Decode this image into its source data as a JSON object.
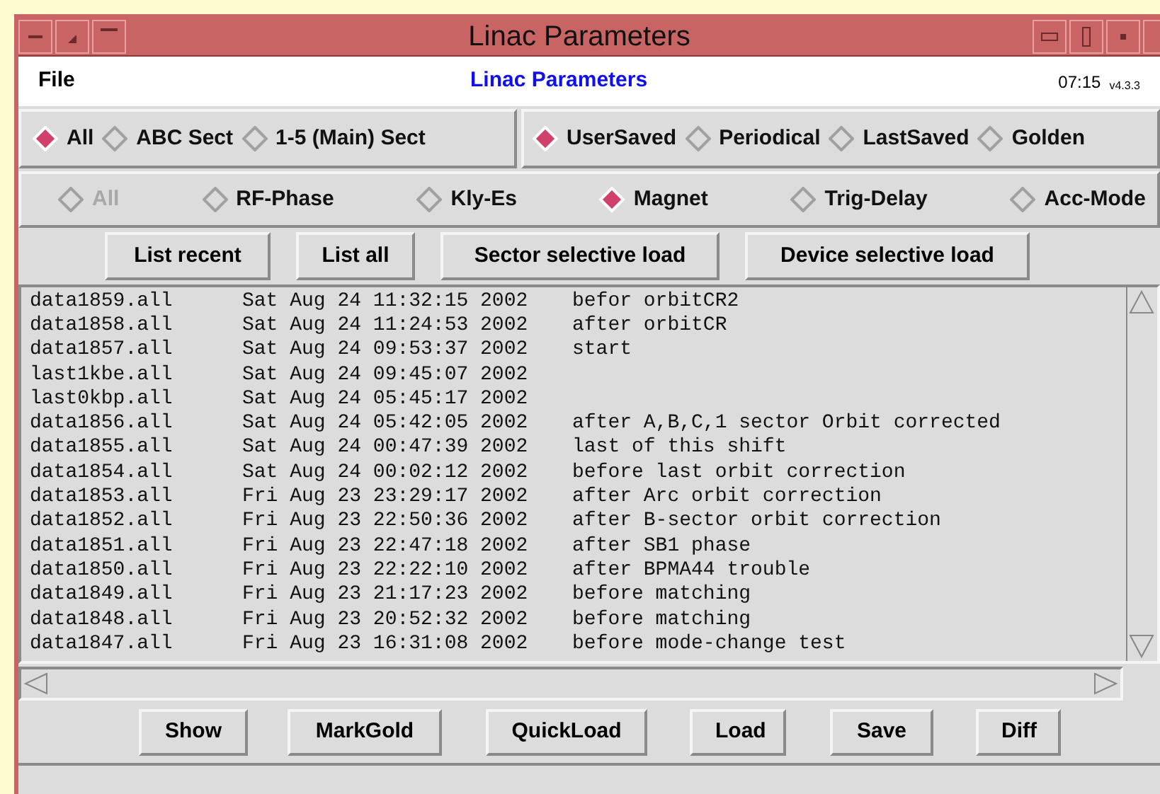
{
  "window": {
    "title": "Linac Parameters"
  },
  "menu": {
    "file": "File",
    "heading": "Linac Parameters",
    "time": "07:15",
    "version": "v4.3.3"
  },
  "section_options": [
    {
      "label": "All",
      "selected": true
    },
    {
      "label": "ABC Sect",
      "selected": false
    },
    {
      "label": "1-5 (Main) Sect",
      "selected": false
    }
  ],
  "source_options": [
    {
      "label": "UserSaved",
      "selected": true
    },
    {
      "label": "Periodical",
      "selected": false
    },
    {
      "label": "LastSaved",
      "selected": false
    },
    {
      "label": "Golden",
      "selected": false
    }
  ],
  "type_options": [
    {
      "label": "All",
      "selected": false,
      "disabled": true
    },
    {
      "label": "RF-Phase",
      "selected": false,
      "disabled": false
    },
    {
      "label": "Kly-Es",
      "selected": false,
      "disabled": false
    },
    {
      "label": "Magnet",
      "selected": true,
      "disabled": false
    },
    {
      "label": "Trig-Delay",
      "selected": false,
      "disabled": false
    },
    {
      "label": "Acc-Mode",
      "selected": false,
      "disabled": false
    }
  ],
  "list_buttons": [
    "List recent",
    "List all",
    "Sector selective load",
    "Device selective load"
  ],
  "files": [
    {
      "name": "data1859.all",
      "date": "Sat Aug 24 11:32:15 2002",
      "comment": "befor orbitCR2"
    },
    {
      "name": "data1858.all",
      "date": "Sat Aug 24 11:24:53 2002",
      "comment": "after orbitCR"
    },
    {
      "name": "data1857.all",
      "date": "Sat Aug 24 09:53:37 2002",
      "comment": "start"
    },
    {
      "name": "last1kbe.all",
      "date": "Sat Aug 24 09:45:07 2002"
    },
    {
      "name": "last0kbp.all",
      "date": "Sat Aug 24 05:45:17 2002"
    },
    {
      "name": "data1856.all",
      "date": "Sat Aug 24 05:42:05 2002",
      "comment": "after A,B,C,1 sector Orbit corrected"
    },
    {
      "name": "data1855.all",
      "date": "Sat Aug 24 00:47:39 2002",
      "comment": "last of this shift"
    },
    {
      "name": "data1854.all",
      "date": "Sat Aug 24 00:02:12 2002",
      "comment": "before last orbit correction"
    },
    {
      "name": "data1853.all",
      "date": "Fri Aug 23 23:29:17 2002",
      "comment": "after Arc orbit correction"
    },
    {
      "name": "data1852.all",
      "date": "Fri Aug 23 22:50:36 2002",
      "comment": "after B-sector orbit correction"
    },
    {
      "name": "data1851.all",
      "date": "Fri Aug 23 22:47:18 2002",
      "comment": "after SB1 phase"
    },
    {
      "name": "data1850.all",
      "date": "Fri Aug 23 22:22:10 2002",
      "comment": "after BPMA44 trouble"
    },
    {
      "name": "data1849.all",
      "date": "Fri Aug 23 21:17:23 2002",
      "comment": "before matching"
    },
    {
      "name": "data1848.all",
      "date": "Fri Aug 23 20:52:32 2002",
      "comment": "before matching"
    },
    {
      "name": "data1847.all",
      "date": "Fri Aug 23 16:31:08 2002",
      "comment": "before mode-change test"
    }
  ],
  "action_buttons": [
    "Show",
    "MarkGold",
    "QuickLoad",
    "Load",
    "Save",
    "Diff"
  ]
}
